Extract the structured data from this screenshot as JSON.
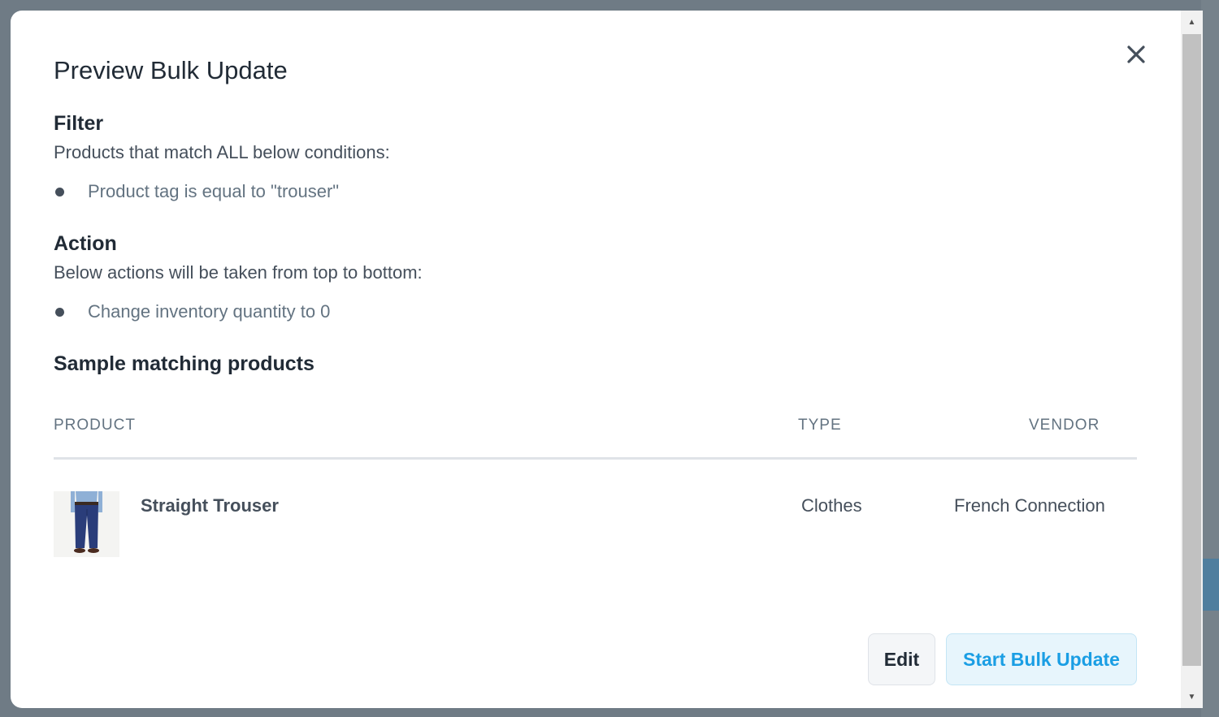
{
  "modal": {
    "title": "Preview Bulk Update",
    "close_icon": "close-icon"
  },
  "filter": {
    "heading": "Filter",
    "description": "Products that match ALL below conditions:",
    "conditions": [
      "Product tag is equal to \"trouser\""
    ]
  },
  "action": {
    "heading": "Action",
    "description": "Below actions will be taken from top to bottom:",
    "actions": [
      "Change inventory quantity to 0"
    ]
  },
  "sample": {
    "heading": "Sample matching products",
    "columns": {
      "product": "PRODUCT",
      "type": "TYPE",
      "vendor": "VENDOR"
    },
    "rows": [
      {
        "image_icon": "product-thumbnail",
        "name": "Straight Trouser",
        "type": "Clothes",
        "vendor": "French Connection"
      }
    ]
  },
  "footer": {
    "edit_label": "Edit",
    "start_label": "Start Bulk Update"
  },
  "colors": {
    "primary_text": "#212b36",
    "muted_text": "#637381",
    "start_button_text": "#1a9ee4",
    "start_button_bg": "#e7f5fc"
  }
}
